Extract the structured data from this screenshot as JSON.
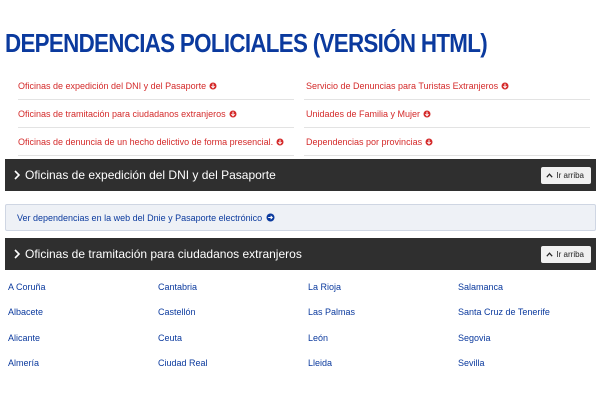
{
  "page": {
    "title": "DEPENDENCIAS POLICIALES (VERSIÓN HTML)"
  },
  "colors": {
    "title": "#0b3a9e",
    "link_red": "#d42a2a",
    "bar_dark": "#2f2f2f",
    "link_blue": "#0b3a9e"
  },
  "index_links": [
    {
      "label": "Oficinas de expedición del DNI y del Pasaporte",
      "icon": "arrow-down-circle-icon"
    },
    {
      "label": "Servicio de Denuncias para Turistas Extranjeros",
      "icon": "arrow-down-circle-icon"
    },
    {
      "label": "Oficinas de tramitación para ciudadanos extranjeros",
      "icon": "arrow-down-circle-icon"
    },
    {
      "label": "Unidades de Familia y Mujer",
      "icon": "arrow-down-circle-icon"
    },
    {
      "label": "Oficinas de denuncia de un hecho delictivo de forma presencial.",
      "icon": "arrow-down-circle-icon"
    },
    {
      "label": "Dependencias por provincias",
      "icon": "arrow-down-circle-icon"
    }
  ],
  "sections": [
    {
      "title": "Oficinas de expedición del DNI y del Pasaporte",
      "up_label": "Ir arriba"
    },
    {
      "title": "Oficinas de tramitación para ciudadanos extranjeros",
      "up_label": "Ir arriba"
    }
  ],
  "dni_box": {
    "link_label": "Ver dependencias en la web del Dnie y Pasaporte electrónico",
    "icon": "arrow-right-circle-icon"
  },
  "cities": [
    "A Coruña",
    "Cantabria",
    "La Rioja",
    "Salamanca",
    "Albacete",
    "Castellón",
    "Las Palmas",
    "Santa Cruz de Tenerife",
    "Alicante",
    "Ceuta",
    "León",
    "Segovia",
    "Almería",
    "Ciudad Real",
    "Lleida",
    "Sevilla"
  ]
}
